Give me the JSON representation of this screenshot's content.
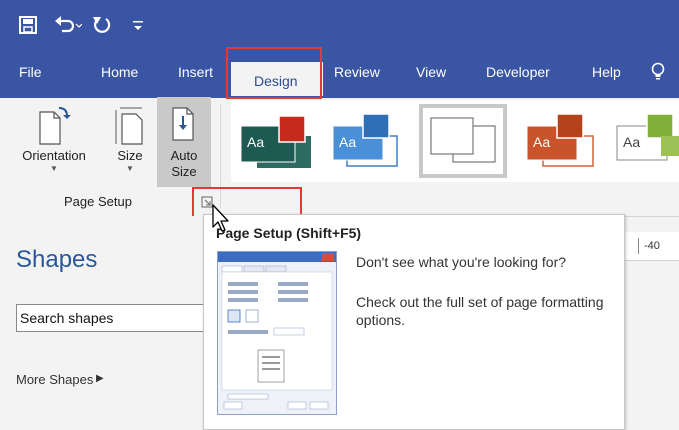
{
  "title_bar": {
    "icons": [
      "save-icon",
      "undo-icon",
      "redo-icon",
      "customize-qat-icon"
    ]
  },
  "tabs": [
    {
      "name": "tab-file",
      "label": "File"
    },
    {
      "name": "tab-home",
      "label": "Home"
    },
    {
      "name": "tab-insert",
      "label": "Insert"
    },
    {
      "name": "tab-design",
      "label": "Design"
    },
    {
      "name": "tab-review",
      "label": "Review"
    },
    {
      "name": "tab-view",
      "label": "View"
    },
    {
      "name": "tab-developer",
      "label": "Developer"
    },
    {
      "name": "tab-help",
      "label": "Help"
    }
  ],
  "active_tab": "Design",
  "ribbon": {
    "orientation_label": "Orientation",
    "size_label": "Size",
    "auto_size_label_1": "Auto",
    "auto_size_label_2": "Size",
    "group_label": "Page Setup",
    "theme_label": "Aa"
  },
  "tooltip": {
    "title": "Page Setup (Shift+F5)",
    "line1": "Don't see what you're looking for?",
    "line2": "Check out the full set of page formatting options."
  },
  "shapes_pane": {
    "title": "Shapes",
    "search_value": "Search shapes",
    "more_shapes_label": "More Shapes"
  },
  "ruler": {
    "tick_label": "-40"
  },
  "colors": {
    "title_bar": "#3955a3",
    "highlight_red": "#e53935",
    "accent_blue": "#2b579a"
  }
}
